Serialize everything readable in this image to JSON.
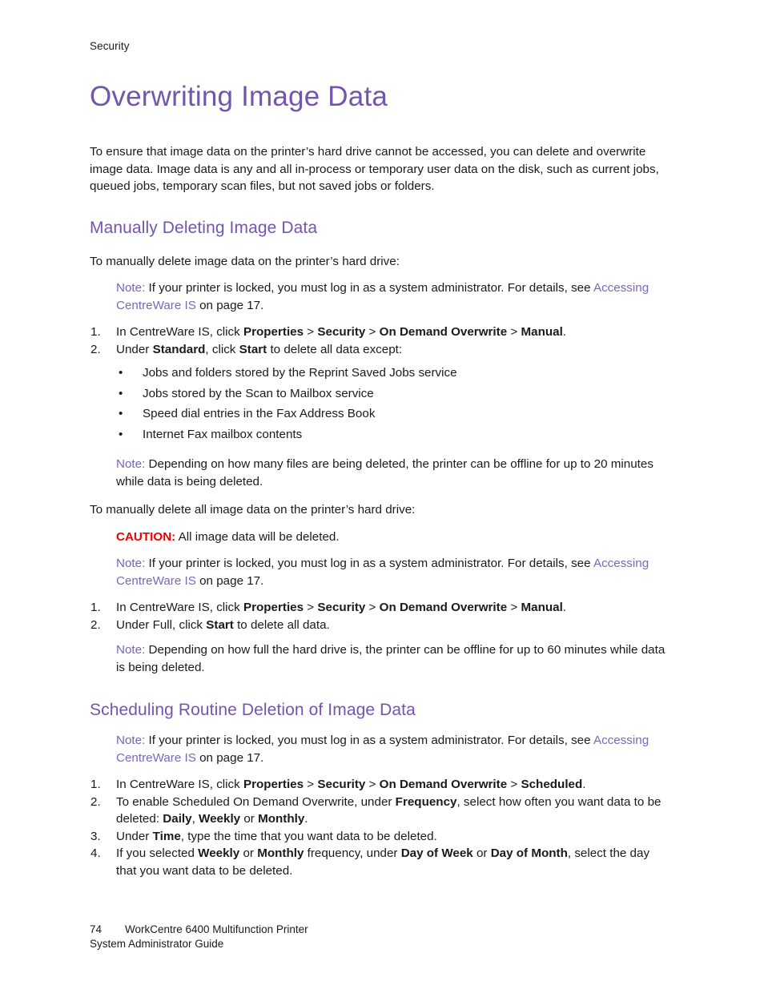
{
  "page": {
    "running_header": "Security",
    "number": "74"
  },
  "title": "Overwriting Image Data",
  "intro": "To ensure that image data on the printer’s hard drive cannot be accessed, you can delete and overwrite image data. Image data is any and all in-process or temporary user data on the disk, such as current jobs, queued jobs, temporary scan files, but not saved jobs or folders.",
  "sections": [
    {
      "heading": "Manually Deleting Image Data",
      "lead": "To manually delete image data on the printer’s hard drive:",
      "note1": {
        "label": "Note:",
        "text_before_link": " If your printer is locked, you must log in as a system administrator. For details, see ",
        "link": "Accessing CentreWare IS",
        "text_after_link": " on page 17."
      },
      "steps": [
        {
          "num": "1.",
          "parts": [
            {
              "t": "In CentreWare IS, click ",
              "b": false
            },
            {
              "t": "Properties",
              "b": true
            },
            {
              "t": " > ",
              "b": false
            },
            {
              "t": "Security",
              "b": true
            },
            {
              "t": " > ",
              "b": false
            },
            {
              "t": "On Demand Overwrite",
              "b": true
            },
            {
              "t": " > ",
              "b": false
            },
            {
              "t": "Manual",
              "b": true
            },
            {
              "t": ".",
              "b": false
            }
          ]
        },
        {
          "num": "2.",
          "parts": [
            {
              "t": "Under ",
              "b": false
            },
            {
              "t": "Standard",
              "b": true
            },
            {
              "t": ", click ",
              "b": false
            },
            {
              "t": "Start",
              "b": true
            },
            {
              "t": " to delete all data except:",
              "b": false
            }
          ]
        }
      ],
      "bullets": [
        "Jobs and folders stored by the Reprint Saved Jobs service",
        "Jobs stored by the Scan to Mailbox service",
        "Speed dial entries in the Fax Address Book",
        "Internet Fax mailbox contents"
      ],
      "note2": {
        "label": "Note:",
        "text": " Depending on how many files are being deleted, the printer can be offline for up to 20 minutes while data is being deleted."
      },
      "lead2": "To manually delete all image data on the printer’s hard drive:",
      "caution": {
        "label": "CAUTION:",
        "text": " All image data will be deleted."
      },
      "note3": {
        "label": "Note:",
        "text_before_link": " If your printer is locked, you must log in as a system administrator. For details, see ",
        "link": "Accessing CentreWare IS",
        "text_after_link": " on page 17."
      },
      "steps2": [
        {
          "num": "1.",
          "parts": [
            {
              "t": "In CentreWare IS, click ",
              "b": false
            },
            {
              "t": "Properties",
              "b": true
            },
            {
              "t": " > ",
              "b": false
            },
            {
              "t": "Security",
              "b": true
            },
            {
              "t": " > ",
              "b": false
            },
            {
              "t": "On Demand Overwrite",
              "b": true
            },
            {
              "t": " > ",
              "b": false
            },
            {
              "t": "Manual",
              "b": true
            },
            {
              "t": ".",
              "b": false
            }
          ]
        },
        {
          "num": "2.",
          "parts": [
            {
              "t": "Under Full, click ",
              "b": false
            },
            {
              "t": "Start",
              "b": true
            },
            {
              "t": " to delete all data.",
              "b": false
            }
          ]
        }
      ],
      "note4": {
        "label": "Note:",
        "text": " Depending on how full the hard drive is, the printer can be offline for up to 60 minutes while data is being deleted."
      }
    },
    {
      "heading": "Scheduling Routine Deletion of Image Data",
      "note1": {
        "label": "Note:",
        "text_before_link": " If your printer is locked, you must log in as a system administrator. For details, see ",
        "link": "Accessing CentreWare IS",
        "text_after_link": " on page 17."
      },
      "steps": [
        {
          "num": "1.",
          "parts": [
            {
              "t": "In CentreWare IS, click ",
              "b": false
            },
            {
              "t": "Properties",
              "b": true
            },
            {
              "t": " > ",
              "b": false
            },
            {
              "t": "Security",
              "b": true
            },
            {
              "t": " > ",
              "b": false
            },
            {
              "t": "On Demand Overwrite",
              "b": true
            },
            {
              "t": " > ",
              "b": false
            },
            {
              "t": "Scheduled",
              "b": true
            },
            {
              "t": ".",
              "b": false
            }
          ]
        },
        {
          "num": "2.",
          "parts": [
            {
              "t": "To enable Scheduled On Demand Overwrite, under ",
              "b": false
            },
            {
              "t": "Frequency",
              "b": true
            },
            {
              "t": ", select how often you want data to be deleted: ",
              "b": false
            },
            {
              "t": "Daily",
              "b": true
            },
            {
              "t": ", ",
              "b": false
            },
            {
              "t": "Weekly",
              "b": true
            },
            {
              "t": " or ",
              "b": false
            },
            {
              "t": "Monthly",
              "b": true
            },
            {
              "t": ".",
              "b": false
            }
          ]
        },
        {
          "num": "3.",
          "parts": [
            {
              "t": "Under ",
              "b": false
            },
            {
              "t": "Time",
              "b": true
            },
            {
              "t": ", type the time that you want data to be deleted.",
              "b": false
            }
          ]
        },
        {
          "num": "4.",
          "parts": [
            {
              "t": "If you selected ",
              "b": false
            },
            {
              "t": "Weekly",
              "b": true
            },
            {
              "t": " or ",
              "b": false
            },
            {
              "t": "Monthly",
              "b": true
            },
            {
              "t": " frequency, under ",
              "b": false
            },
            {
              "t": "Day of Week",
              "b": true
            },
            {
              "t": " or ",
              "b": false
            },
            {
              "t": "Day of Month",
              "b": true
            },
            {
              "t": ", select the day that you want data to be deleted.",
              "b": false
            }
          ]
        }
      ]
    }
  ],
  "footer": {
    "page_number": "74",
    "line1": "WorkCentre 6400 Multifunction Printer",
    "line2": "System Administrator Guide"
  },
  "colors": {
    "heading_purple": "#7355ac",
    "note_purple": "#7a62b4",
    "link_purple": "#7a68b8",
    "caution_red": "#ee0000",
    "body_black": "#1a1a1a"
  },
  "bullet_glyph": "•"
}
